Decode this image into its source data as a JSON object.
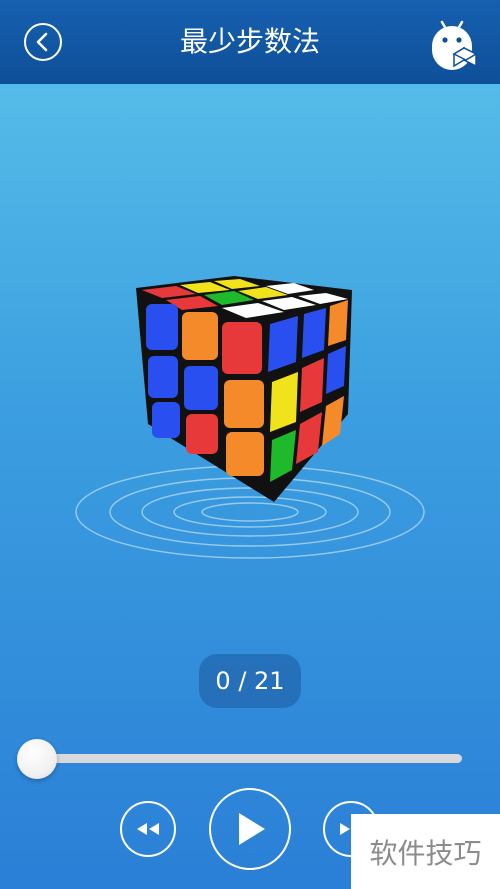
{
  "header": {
    "title": "最少步数法",
    "back_icon": "chevron-left-icon",
    "robot_icon": "android-cube-icon"
  },
  "counter": {
    "text": "0 / 21",
    "current_step": 0,
    "total_steps": 21
  },
  "slider": {
    "progress": 0.0
  },
  "controls": {
    "rewind_icon": "rewind-icon",
    "play_icon": "play-icon",
    "forward_icon": "fast-forward-icon"
  },
  "watermark": {
    "text": "软件技巧"
  },
  "colors": {
    "header_bg": "#0e4f98",
    "bg_top": "#5cc3ea",
    "bg_bottom": "#2a7fd6",
    "cube_red": "#e8393a",
    "cube_blue": "#2a4ff0",
    "cube_green": "#1fb92c",
    "cube_orange": "#f58a2b",
    "cube_yellow": "#f0e31c",
    "cube_white": "#ffffff"
  }
}
